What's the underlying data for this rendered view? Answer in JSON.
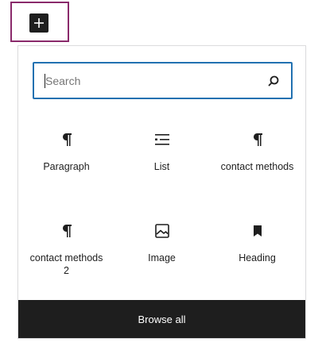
{
  "inserter": {
    "toggle_icon": "plus-icon"
  },
  "search": {
    "placeholder": "Search",
    "value": "",
    "icon": "search-icon"
  },
  "blocks": [
    {
      "label": "Paragraph",
      "icon": "paragraph-icon"
    },
    {
      "label": "List",
      "icon": "list-icon"
    },
    {
      "label": "contact methods",
      "icon": "paragraph-icon"
    },
    {
      "label": "contact methods 2",
      "icon": "paragraph-icon"
    },
    {
      "label": "Image",
      "icon": "image-icon"
    },
    {
      "label": "Heading",
      "icon": "bookmark-icon"
    }
  ],
  "footer": {
    "browse_all_label": "Browse all"
  },
  "colors": {
    "focus_border": "#2271b1",
    "highlight_border": "#8a2a6b",
    "dark": "#1e1e1e"
  }
}
